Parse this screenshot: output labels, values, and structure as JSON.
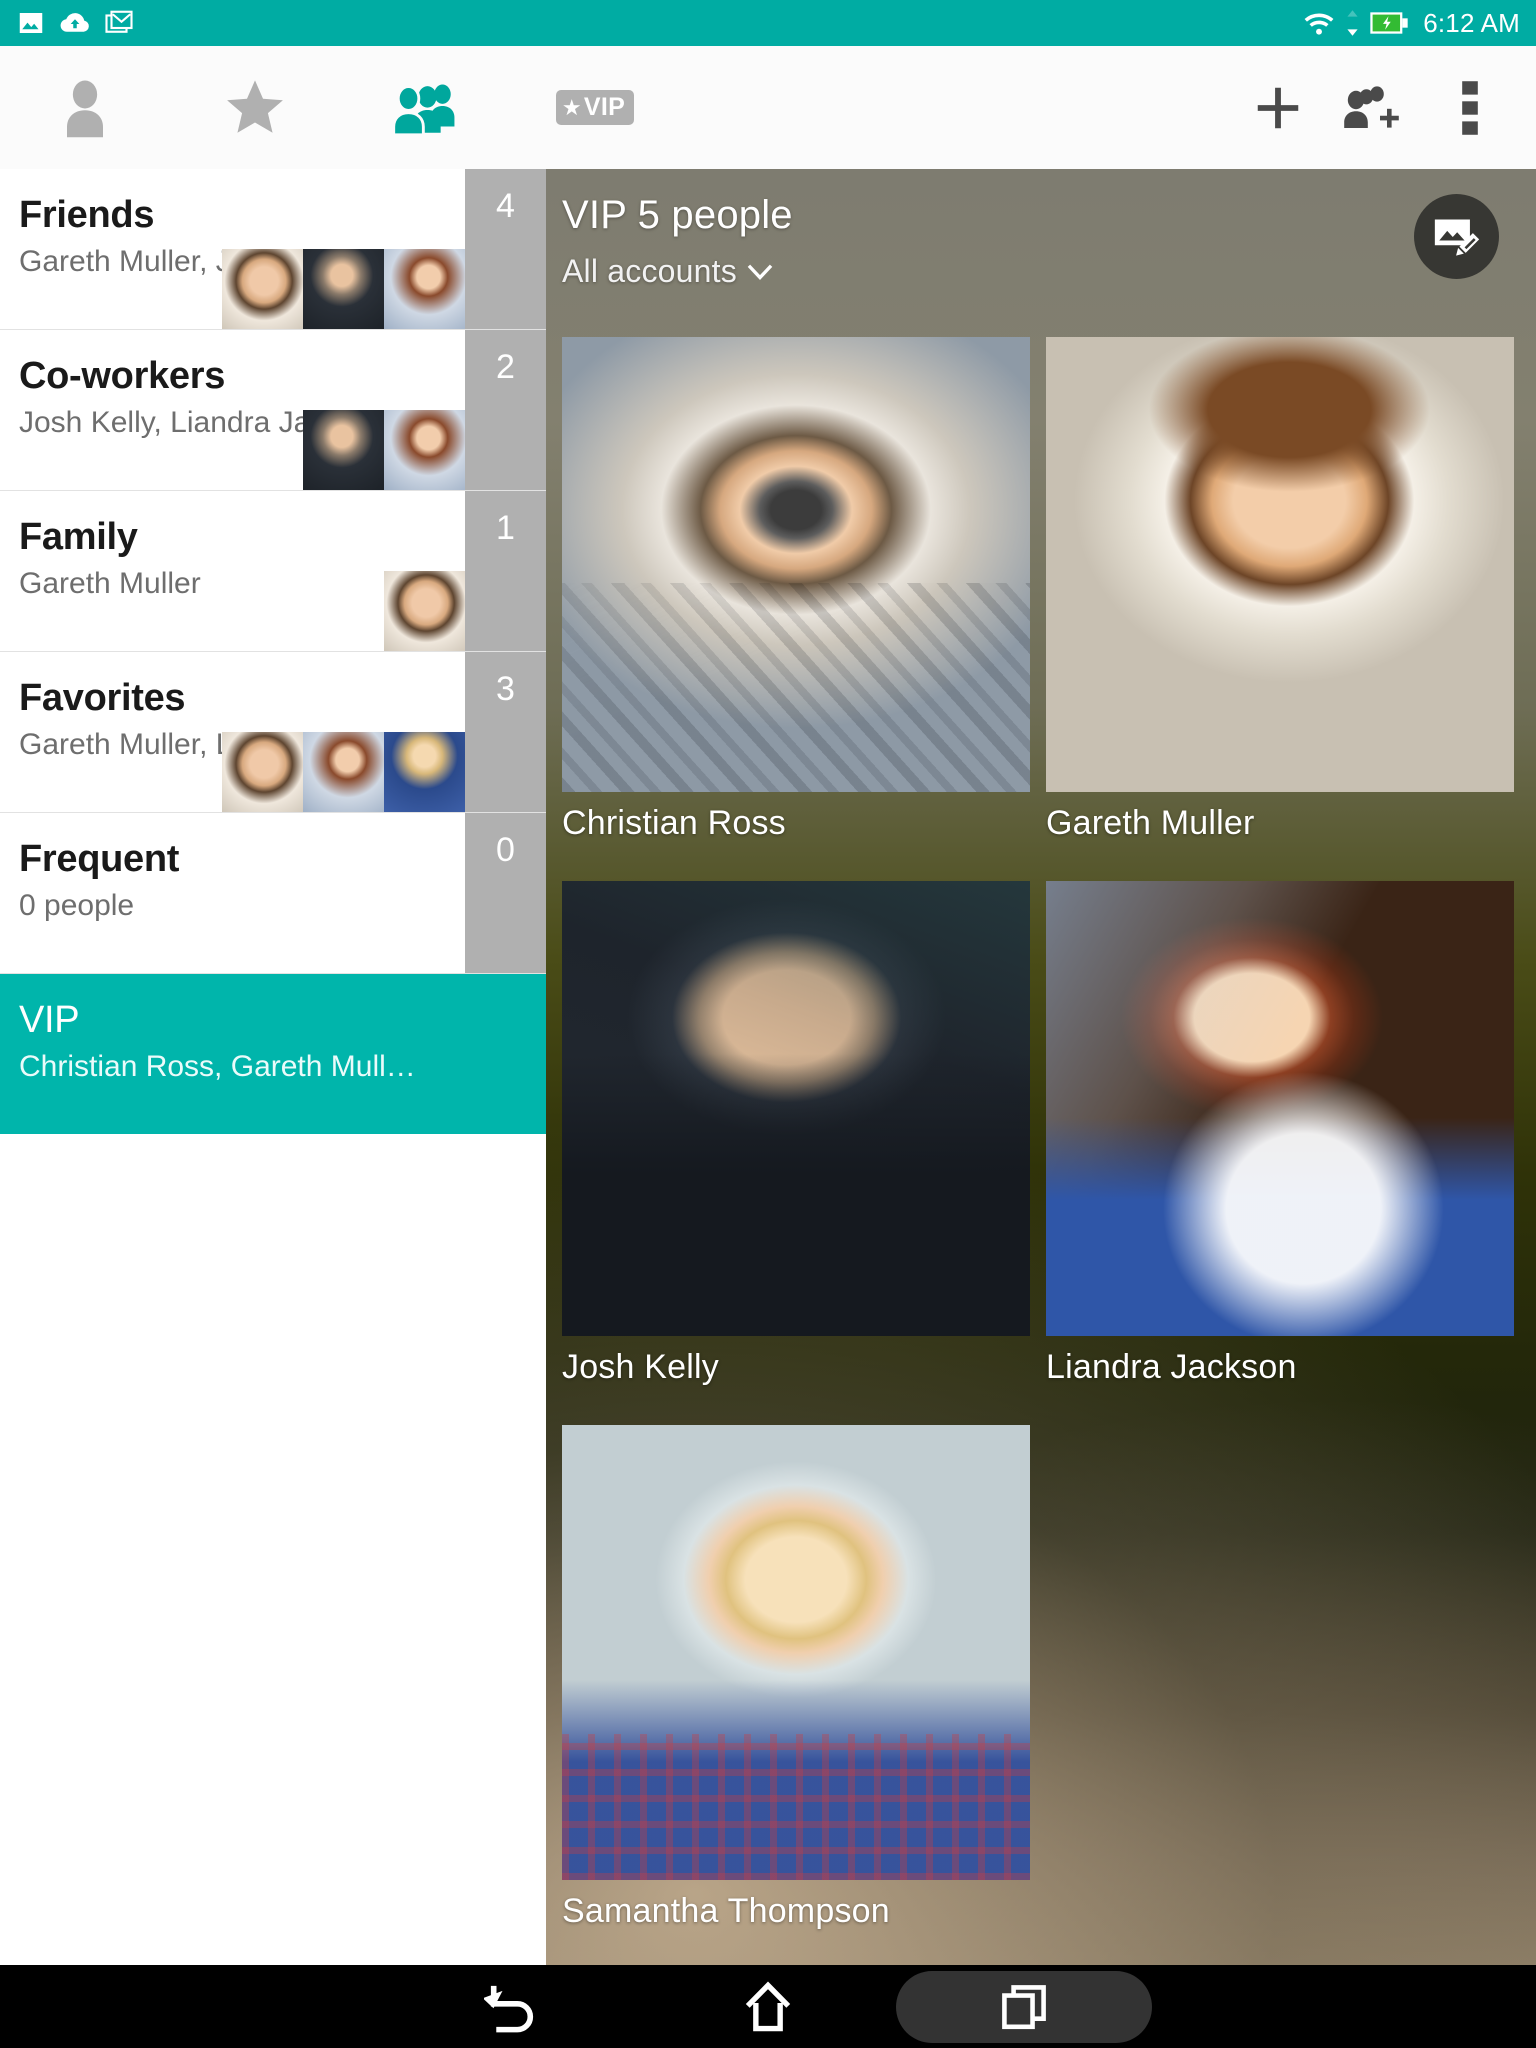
{
  "status_bar": {
    "background_color": "#00aca3",
    "time": "6:12 AM",
    "left_icons": [
      "photo-icon",
      "cloud-upload-icon",
      "gmail-icon"
    ],
    "right_icons": [
      "wifi-icon",
      "data-transfer-icon",
      "battery-charging-icon"
    ]
  },
  "app_bar": {
    "background_color": "#fbfbfb",
    "tabs": [
      {
        "name": "contacts",
        "icon": "person-icon",
        "active": false
      },
      {
        "name": "favorites",
        "icon": "star-icon",
        "active": false
      },
      {
        "name": "groups",
        "icon": "people-group-icon",
        "active": true
      },
      {
        "name": "vip",
        "icon": "vip-badge-icon",
        "label": "VIP",
        "active": false
      }
    ],
    "actions": [
      {
        "name": "add",
        "icon": "plus-icon"
      },
      {
        "name": "add-group",
        "icon": "add-people-icon"
      },
      {
        "name": "overflow",
        "icon": "more-vertical-icon"
      }
    ],
    "active_tab_color": "#00a79d",
    "inactive_tab_color": "#b0b0b0"
  },
  "sidebar": {
    "selected_color": "#00b5ab",
    "count_strip_color": "#b0b0b0",
    "groups": [
      {
        "name": "friends",
        "title": "Friends",
        "subtitle": "Gareth Muller, J…",
        "count": "4",
        "thumbs": 3,
        "selected": false
      },
      {
        "name": "co-workers",
        "title": "Co-workers",
        "subtitle": "Josh Kelly, Liandra Ja…",
        "count": "2",
        "thumbs": 2,
        "selected": false
      },
      {
        "name": "family",
        "title": "Family",
        "subtitle": "Gareth Muller",
        "count": "1",
        "thumbs": 1,
        "selected": false
      },
      {
        "name": "favorites",
        "title": "Favorites",
        "subtitle": "Gareth Muller, Li…",
        "count": "3",
        "thumbs": 3,
        "selected": false
      },
      {
        "name": "frequent",
        "title": "Frequent",
        "subtitle": "0 people",
        "count": "0",
        "thumbs": 0,
        "selected": false
      },
      {
        "name": "vip",
        "title": "VIP",
        "subtitle": "Christian Ross, Gareth Mull…",
        "count": "",
        "thumbs": 0,
        "selected": true
      }
    ]
  },
  "panel": {
    "title": "VIP 5 people",
    "account_filter": "All accounts",
    "account_chevron": "chevron-down-icon",
    "fab": {
      "name": "edit-cover-photo",
      "icon": "image-edit-icon",
      "color": "#373733"
    },
    "contacts": [
      {
        "name": "Christian Ross"
      },
      {
        "name": "Gareth Muller"
      },
      {
        "name": "Josh Kelly"
      },
      {
        "name": "Liandra Jackson"
      },
      {
        "name": "Samantha Thompson"
      }
    ]
  },
  "nav_bar": {
    "background_color": "#000000",
    "buttons": [
      {
        "name": "back",
        "icon": "back-arrow-icon",
        "active": false
      },
      {
        "name": "home",
        "icon": "home-icon",
        "active": false
      },
      {
        "name": "recents",
        "icon": "recents-icon",
        "active": true
      }
    ]
  }
}
